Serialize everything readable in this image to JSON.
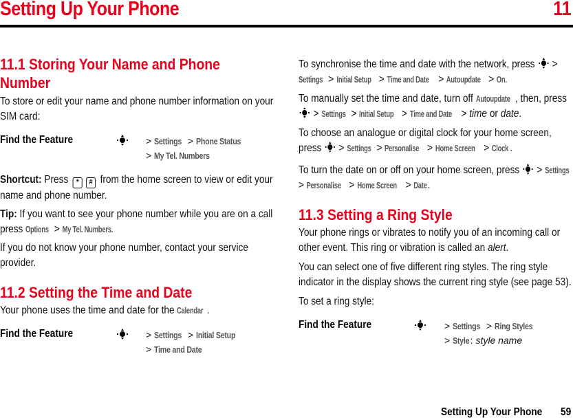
{
  "header": {
    "chapter_title": "Setting Up Your Phone",
    "chapter_number": "11"
  },
  "colors": {
    "heading_red": "#e8001c",
    "menu_gray": "#555555"
  },
  "section_11_1": {
    "heading": "11.1 Storing Your Name and Phone Number",
    "intro": "To store or edit your name and phone number information on your SIM card:",
    "find_feature": {
      "label": "Find the Feature",
      "icon": "nav-key-icon",
      "line1": [
        "Settings",
        "Phone Status"
      ],
      "line2": [
        "My Tel. Numbers"
      ]
    },
    "shortcut": {
      "label": "Shortcut:",
      "pre": "Press",
      "keys": [
        "*",
        "#"
      ],
      "post": "from the home screen to view or edit your name and phone number."
    },
    "tip": {
      "label": "Tip:",
      "text": "If you want to see your phone number while you are on a call press",
      "menu1": "Options",
      "menu2": "My Tel. Numbers."
    },
    "note": "If you do not know your phone number, contact your service provider."
  },
  "section_11_2": {
    "heading": "11.2 Setting the Time and Date",
    "intro_pre": "Your phone uses the time and date for the",
    "intro_menu": "Calendar",
    "intro_post": ".",
    "find_feature": {
      "label": "Find the Feature",
      "icon": "nav-key-icon",
      "line1": [
        "Settings",
        "Initial Setup"
      ],
      "line2": [
        "Time and Date"
      ]
    },
    "sync": {
      "text": "To synchronise the time and date with the network, press",
      "path": [
        "Settings",
        "Initial Setup",
        "Time and Date",
        "Autoupdate",
        "On"
      ]
    },
    "manual": {
      "text_pre": "To manually set the time and date, turn off",
      "menu": "Autoupdate",
      "text_post": ", then, press",
      "path": [
        "Settings",
        "Initial Setup",
        "Time and Date"
      ],
      "end_italic1": "time",
      "end_or": "or",
      "end_italic2": "date"
    },
    "clock": {
      "text": "To choose an analogue or digital clock for your home screen, press",
      "path": [
        "Settings",
        "Personalise",
        "Home Screen",
        "Clock"
      ]
    },
    "date_toggle": {
      "text": "To turn the date on or off on your home screen, press",
      "path": [
        "Settings",
        "Personalise",
        "Home Screen",
        "Date"
      ]
    }
  },
  "section_11_3": {
    "heading": "11.3 Setting a Ring Style",
    "para1_pre": "Your phone rings or vibrates to notify you of an incoming call or other event. This ring or vibration is called an",
    "para1_italic": "alert",
    "para2": "You can select one of five different ring styles. The ring style indicator in the display shows the current ring style (see page 53).",
    "para3": "To set a ring style:",
    "find_feature": {
      "label": "Find the Feature",
      "icon": "nav-key-icon",
      "line1": [
        "Settings",
        "Ring Styles"
      ],
      "line2_menu": "Style",
      "line2_italic": "style name"
    }
  },
  "footer": {
    "title": "Setting Up Your Phone",
    "page": "59"
  }
}
